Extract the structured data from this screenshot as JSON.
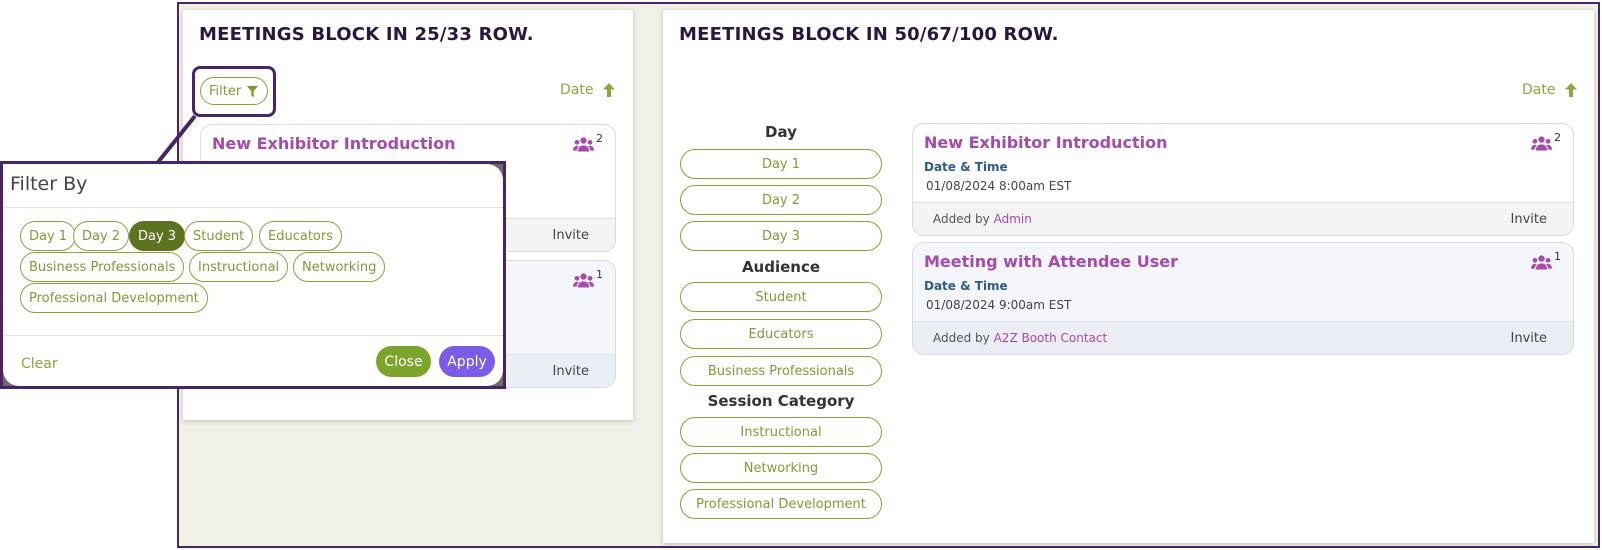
{
  "colors": {
    "frame_border": "#4a2566",
    "accent_green": "#84a637",
    "active_chip": "#5d7320",
    "title_purple": "#a64aad",
    "apply_button": "#7a5ce8",
    "close_button": "#7ca52c",
    "date_label": "#2f5b8a"
  },
  "left_block": {
    "heading": "MEETINGS BLOCK IN 25/33 ROW.",
    "filter_label": "Filter",
    "filter_icon": "funnel-icon",
    "sort_label": "Date",
    "sort_icon": "arrow-up-icon",
    "meetings": [
      {
        "title": "New Exhibitor Introduction",
        "attendee_count": "2",
        "invite_label": "Invite"
      },
      {
        "attendee_count": "1",
        "invite_label": "Invite"
      }
    ]
  },
  "filter_popup": {
    "title": "Filter By",
    "chips": [
      {
        "label": "Day 1",
        "active": false
      },
      {
        "label": "Day 2",
        "active": false
      },
      {
        "label": "Day 3",
        "active": true
      },
      {
        "label": "Student",
        "active": false
      },
      {
        "label": "Educators",
        "active": false
      },
      {
        "label": "Business Professionals",
        "active": false
      },
      {
        "label": "Instructional",
        "active": false
      },
      {
        "label": "Networking",
        "active": false
      },
      {
        "label": "Professional Development",
        "active": false
      }
    ],
    "clear_label": "Clear",
    "close_label": "Close",
    "apply_label": "Apply"
  },
  "right_block": {
    "heading": "MEETINGS BLOCK IN 50/67/100 ROW.",
    "sort_label": "Date",
    "sort_icon": "arrow-up-icon",
    "filter_groups": [
      {
        "label": "Day",
        "options": [
          "Day 1",
          "Day 2",
          "Day 3"
        ]
      },
      {
        "label": "Audience",
        "options": [
          "Student",
          "Educators",
          "Business Professionals"
        ]
      },
      {
        "label": "Session Category",
        "options": [
          "Instructional",
          "Networking",
          "Professional Development"
        ]
      }
    ],
    "meetings": [
      {
        "title": "New Exhibitor Introduction",
        "attendee_count": "2",
        "datetime_label": "Date & Time",
        "datetime_value": "01/08/2024 8:00am EST",
        "added_by_prefix": "Added by",
        "added_by": "Admin",
        "invite_label": "Invite"
      },
      {
        "title": "Meeting with Attendee User",
        "attendee_count": "1",
        "datetime_label": "Date & Time",
        "datetime_value": "01/08/2024 9:00am EST",
        "added_by_prefix": "Added by",
        "added_by": "A2Z Booth Contact",
        "invite_label": "Invite"
      }
    ]
  }
}
